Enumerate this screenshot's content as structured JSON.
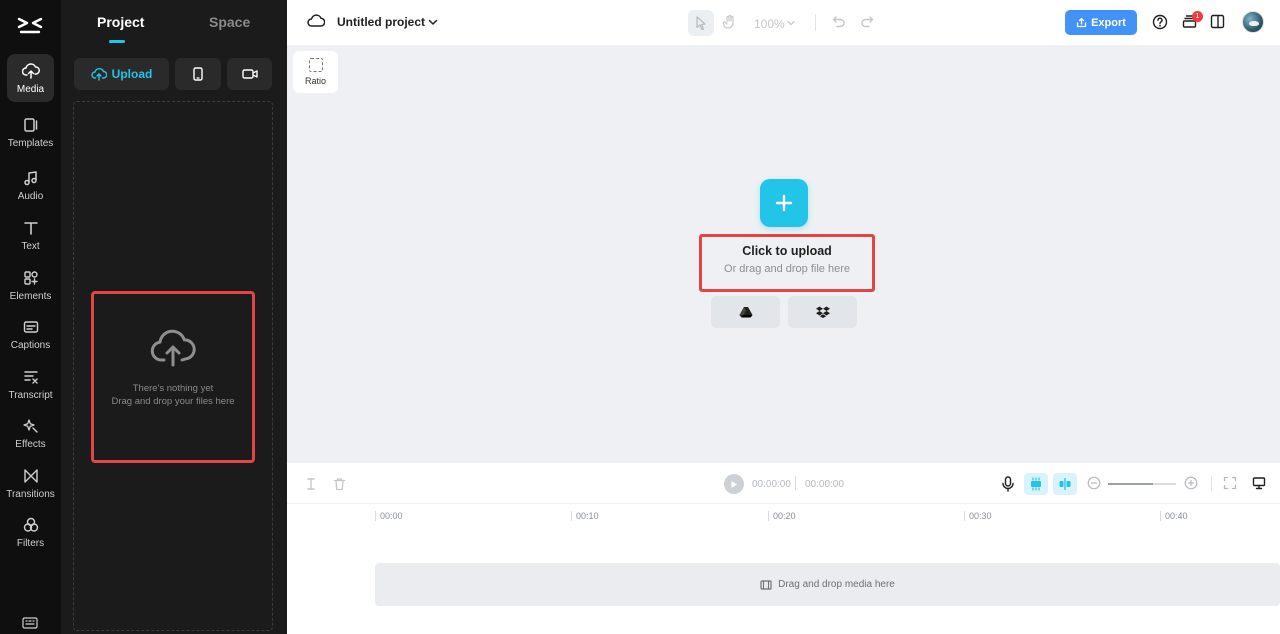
{
  "rail": {
    "items": [
      {
        "label": "Media",
        "icon": "upload-cloud-icon",
        "active": true
      },
      {
        "label": "Templates",
        "icon": "templates-icon"
      },
      {
        "label": "Audio",
        "icon": "music-note-icon"
      },
      {
        "label": "Text",
        "icon": "text-t-icon"
      },
      {
        "label": "Elements",
        "icon": "elements-icon"
      },
      {
        "label": "Captions",
        "icon": "captions-icon"
      },
      {
        "label": "Transcript",
        "icon": "transcript-icon"
      },
      {
        "label": "Effects",
        "icon": "effects-star-icon"
      },
      {
        "label": "Transitions",
        "icon": "transitions-icon"
      },
      {
        "label": "Filters",
        "icon": "filters-icon"
      }
    ]
  },
  "panel": {
    "tabs": [
      "Project",
      "Space"
    ],
    "upload_label": "Upload",
    "empty_title": "There's nothing yet",
    "empty_sub": "Drag and drop your files here"
  },
  "topbar": {
    "project_title": "Untitled project",
    "zoom": "100%",
    "export_label": "Export",
    "notification_count": "1"
  },
  "canvas": {
    "ratio_label": "Ratio",
    "upload_title": "Click to upload",
    "upload_sub": "Or drag and drop file here"
  },
  "timeline": {
    "current_time": "00:00:00",
    "total_time": "00:00:00",
    "ruler_ticks": [
      "00:00",
      "00:10",
      "00:20",
      "00:30",
      "00:40"
    ],
    "drop_hint": "Drag and drop media here"
  },
  "colors": {
    "accent": "#22c5e8",
    "export": "#4292f8",
    "highlight_box": "#e34545",
    "rail_bg": "#0f0f0f",
    "panel_bg": "#1b1b1b",
    "canvas_bg": "#eef0f3"
  }
}
